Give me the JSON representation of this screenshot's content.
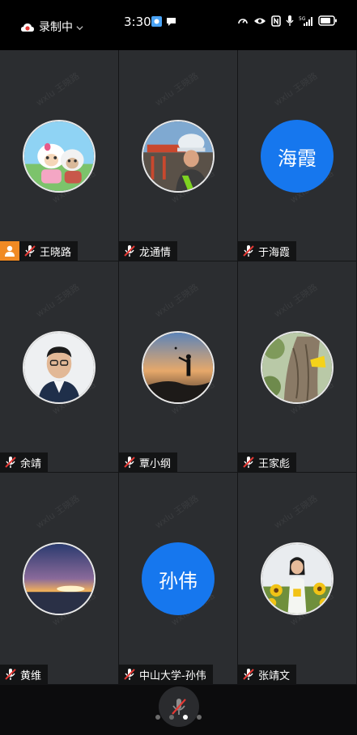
{
  "status_bar": {
    "recording_label": "录制中",
    "time": "3:30",
    "network": "5G"
  },
  "participants": [
    {
      "name": "王晓路",
      "avatar_type": "photo",
      "avatar_desc": "cartoon-sheep",
      "host": true,
      "muted": true
    },
    {
      "name": "龙通情",
      "avatar_type": "photo",
      "avatar_desc": "worker-helmet",
      "host": false,
      "muted": true
    },
    {
      "name": "于海霞",
      "avatar_type": "text",
      "avatar_text": "海霞",
      "host": false,
      "muted": true
    },
    {
      "name": "余靖",
      "avatar_type": "photo",
      "avatar_desc": "man-glasses",
      "host": false,
      "muted": true
    },
    {
      "name": "覃小纲",
      "avatar_type": "photo",
      "avatar_desc": "sunset-silhouette",
      "host": false,
      "muted": true
    },
    {
      "name": "王家彪",
      "avatar_type": "photo",
      "avatar_desc": "tree-bark",
      "host": false,
      "muted": true
    },
    {
      "name": "黄维",
      "avatar_type": "photo",
      "avatar_desc": "sunset-sky",
      "host": false,
      "muted": true
    },
    {
      "name": "中山大学-孙伟",
      "avatar_type": "text",
      "avatar_text": "孙伟",
      "host": false,
      "muted": true
    },
    {
      "name": "张靖文",
      "avatar_type": "photo",
      "avatar_desc": "woman-sunflowers",
      "host": false,
      "muted": true
    }
  ],
  "watermark": "wxlu 王晓路",
  "pager": {
    "pages": 4,
    "current": 3
  },
  "colors": {
    "text_avatar_bg": "#1677ee",
    "host_badge": "#f08a24",
    "mute_red": "#e53935",
    "tile_bg": "#2b2d30"
  }
}
